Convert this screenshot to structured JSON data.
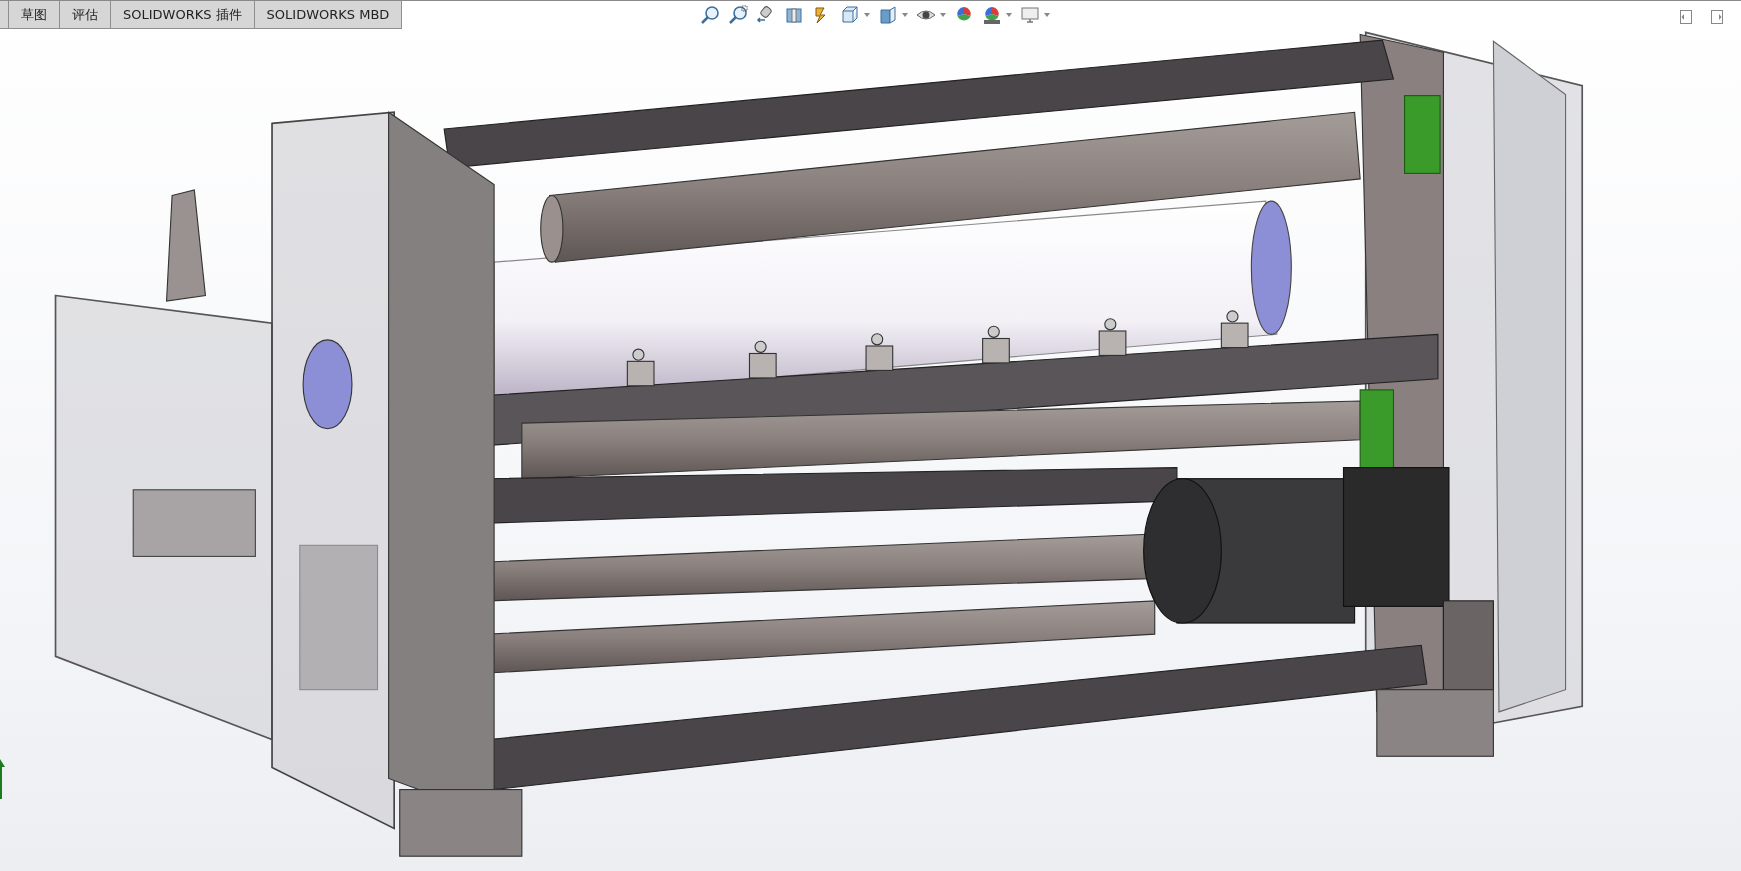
{
  "tabs": [
    {
      "label": "草图"
    },
    {
      "label": "评估"
    },
    {
      "label": "SOLIDWORKS 插件"
    },
    {
      "label": "SOLIDWORKS MBD"
    }
  ],
  "view_toolbar": [
    {
      "kind": "zoom-fit",
      "has_menu": false
    },
    {
      "kind": "zoom-area",
      "has_menu": false
    },
    {
      "kind": "previous-view",
      "has_menu": false
    },
    {
      "kind": "section-view",
      "has_menu": false
    },
    {
      "kind": "dynamic-annotation",
      "has_menu": false
    },
    {
      "kind": "view-orientation",
      "has_menu": true
    },
    {
      "kind": "display-style",
      "has_menu": true
    },
    {
      "kind": "hide-show",
      "has_menu": true
    },
    {
      "kind": "edit-appearance",
      "has_menu": false
    },
    {
      "kind": "apply-scene",
      "has_menu": true
    },
    {
      "kind": "view-settings",
      "has_menu": true
    }
  ]
}
